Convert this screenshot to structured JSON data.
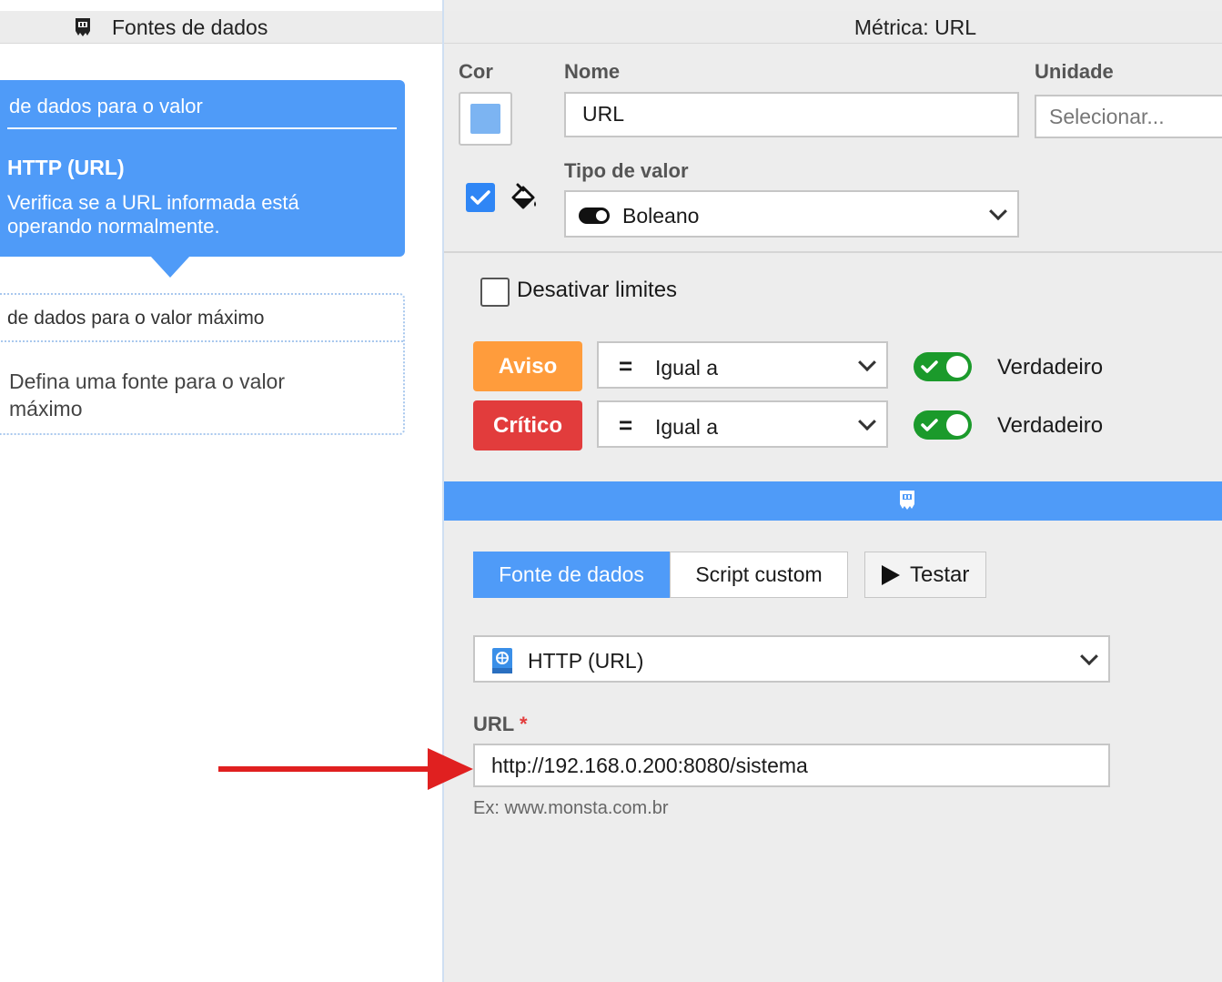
{
  "left_panel": {
    "header_title": "Fontes de dados",
    "header_icon": "monster-logo-icon",
    "value_card": {
      "heading": "de dados para o valor",
      "source_name": "HTTP (URL)",
      "source_desc": "Verifica se a URL informada está operando normalmente."
    },
    "max_card": {
      "heading": "de dados para o valor máximo",
      "placeholder": "Defina uma fonte para o valor máximo"
    }
  },
  "right_panel": {
    "header_title": "Métrica: URL",
    "labels": {
      "color": "Cor",
      "name": "Nome",
      "unit": "Unidade",
      "value_type": "Tipo de valor"
    },
    "color_value": "#7cb4f2",
    "name_value": "URL",
    "unit_placeholder": "Selecionar...",
    "value_type_selected": "Boleano",
    "disable_limits_label": "Desativar limites",
    "limits": [
      {
        "badge": "Aviso",
        "operator_symbol": "=",
        "operator_label": "Igual a",
        "switch_on": true,
        "value_label": "Verdadeiro",
        "color": "#ff9c3c"
      },
      {
        "badge": "Crítico",
        "operator_symbol": "=",
        "operator_label": "Igual a",
        "switch_on": true,
        "value_label": "Verdadeiro",
        "color": "#e23c3c"
      }
    ],
    "tabs": {
      "data_source": "Fonte de dados",
      "custom_script": "Script custom",
      "test_button": "Testar"
    },
    "source_selected": "HTTP (URL)",
    "url_field": {
      "label": "URL",
      "required_mark": "*",
      "value": "http://192.168.0.200:8080/sistema",
      "hint": "Ex: www.monsta.com.br"
    }
  },
  "colors": {
    "accent_blue": "#4f9bf8",
    "warning": "#ff9c3c",
    "critical": "#e23c3c",
    "switch_on": "#1b9a2b",
    "annotation_arrow": "#e02020"
  }
}
